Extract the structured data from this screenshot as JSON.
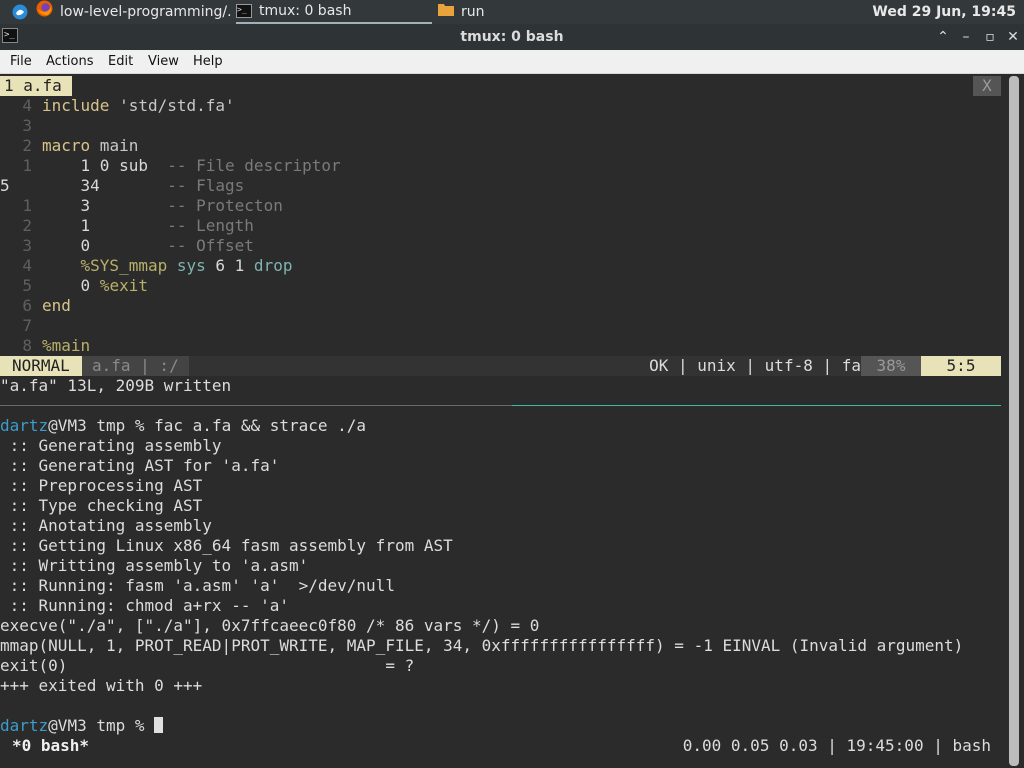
{
  "taskbar": {
    "browser_tab": "low-level-programming/...",
    "terminal_tab": "tmux: 0 bash",
    "folder_tab": "run",
    "clock": "Wed 29 Jun, 19:45"
  },
  "window": {
    "title": "tmux: 0 bash",
    "minimize": "⌃",
    "maximize": "–",
    "restore": "▫",
    "close": "✕"
  },
  "menu": [
    "File",
    "Actions",
    "Edit",
    "View",
    "Help"
  ],
  "vim": {
    "tab_label": "1 a.fa",
    "tab_close": "X",
    "lines": [
      {
        "n": "4",
        "parts": [
          [
            "kw",
            "include"
          ],
          [
            "str",
            " 'std/std.fa'"
          ]
        ]
      },
      {
        "n": "3",
        "parts": []
      },
      {
        "n": "2",
        "parts": [
          [
            "kw",
            "macro"
          ],
          [
            "str",
            " main"
          ]
        ]
      },
      {
        "n": "1",
        "parts": [
          [
            "num",
            "    1 0 sub"
          ],
          [
            "cm",
            "  -- File descriptor"
          ]
        ]
      },
      {
        "n": "5",
        "cur": true,
        "parts": [
          [
            "num",
            "    34"
          ],
          [
            "cm",
            "       -- Flags"
          ]
        ]
      },
      {
        "n": "1",
        "parts": [
          [
            "num",
            "    3"
          ],
          [
            "cm",
            "        -- Protecton"
          ]
        ]
      },
      {
        "n": "2",
        "parts": [
          [
            "num",
            "    1"
          ],
          [
            "cm",
            "        -- Length"
          ]
        ]
      },
      {
        "n": "3",
        "parts": [
          [
            "num",
            "    0"
          ],
          [
            "cm",
            "        -- Offset"
          ]
        ]
      },
      {
        "n": "4",
        "parts": [
          [
            "mac",
            "    %SYS_mmap"
          ],
          [
            "fn",
            " sys"
          ],
          [
            "num",
            " 6 1"
          ],
          [
            "fn",
            " drop"
          ]
        ]
      },
      {
        "n": "5",
        "parts": [
          [
            "num",
            "    0"
          ],
          [
            "mac",
            " %exit"
          ]
        ]
      },
      {
        "n": "6",
        "parts": [
          [
            "kw",
            "end"
          ]
        ]
      },
      {
        "n": "7",
        "parts": []
      },
      {
        "n": "8",
        "parts": [
          [
            "mac",
            "%main"
          ]
        ]
      }
    ],
    "mode": "NORMAL",
    "file_info": "a.fa | :/",
    "status_info": "OK | unix | utf-8 | fa",
    "percent": "38%",
    "position": "5:5",
    "message": "\"a.fa\" 13L, 209B written"
  },
  "shell": {
    "user": "dartz",
    "prompt_rest": "@VM3 tmp % ",
    "command": "fac a.fa && strace ./a",
    "output": [
      " :: Generating assembly",
      " :: Generating AST for 'a.fa'",
      " :: Preprocessing AST",
      " :: Type checking AST",
      " :: Anotating assembly",
      " :: Getting Linux x86_64 fasm assembly from AST",
      " :: Writting assembly to 'a.asm'",
      " :: Running: fasm 'a.asm' 'a'  >/dev/null",
      " :: Running: chmod a+rx -- 'a'",
      "execve(\"./a\", [\"./a\"], 0x7ffcaeec0f80 /* 86 vars */) = 0",
      "mmap(NULL, 1, PROT_READ|PROT_WRITE, MAP_FILE, 34, 0xffffffffffffffff) = -1 EINVAL (Invalid argument)",
      "exit(0)                                 = ?",
      "+++ exited with 0 +++"
    ]
  },
  "tmux": {
    "window": "*0 bash*",
    "right": "0.00 0.05 0.03 | 19:45:00 | bash"
  }
}
